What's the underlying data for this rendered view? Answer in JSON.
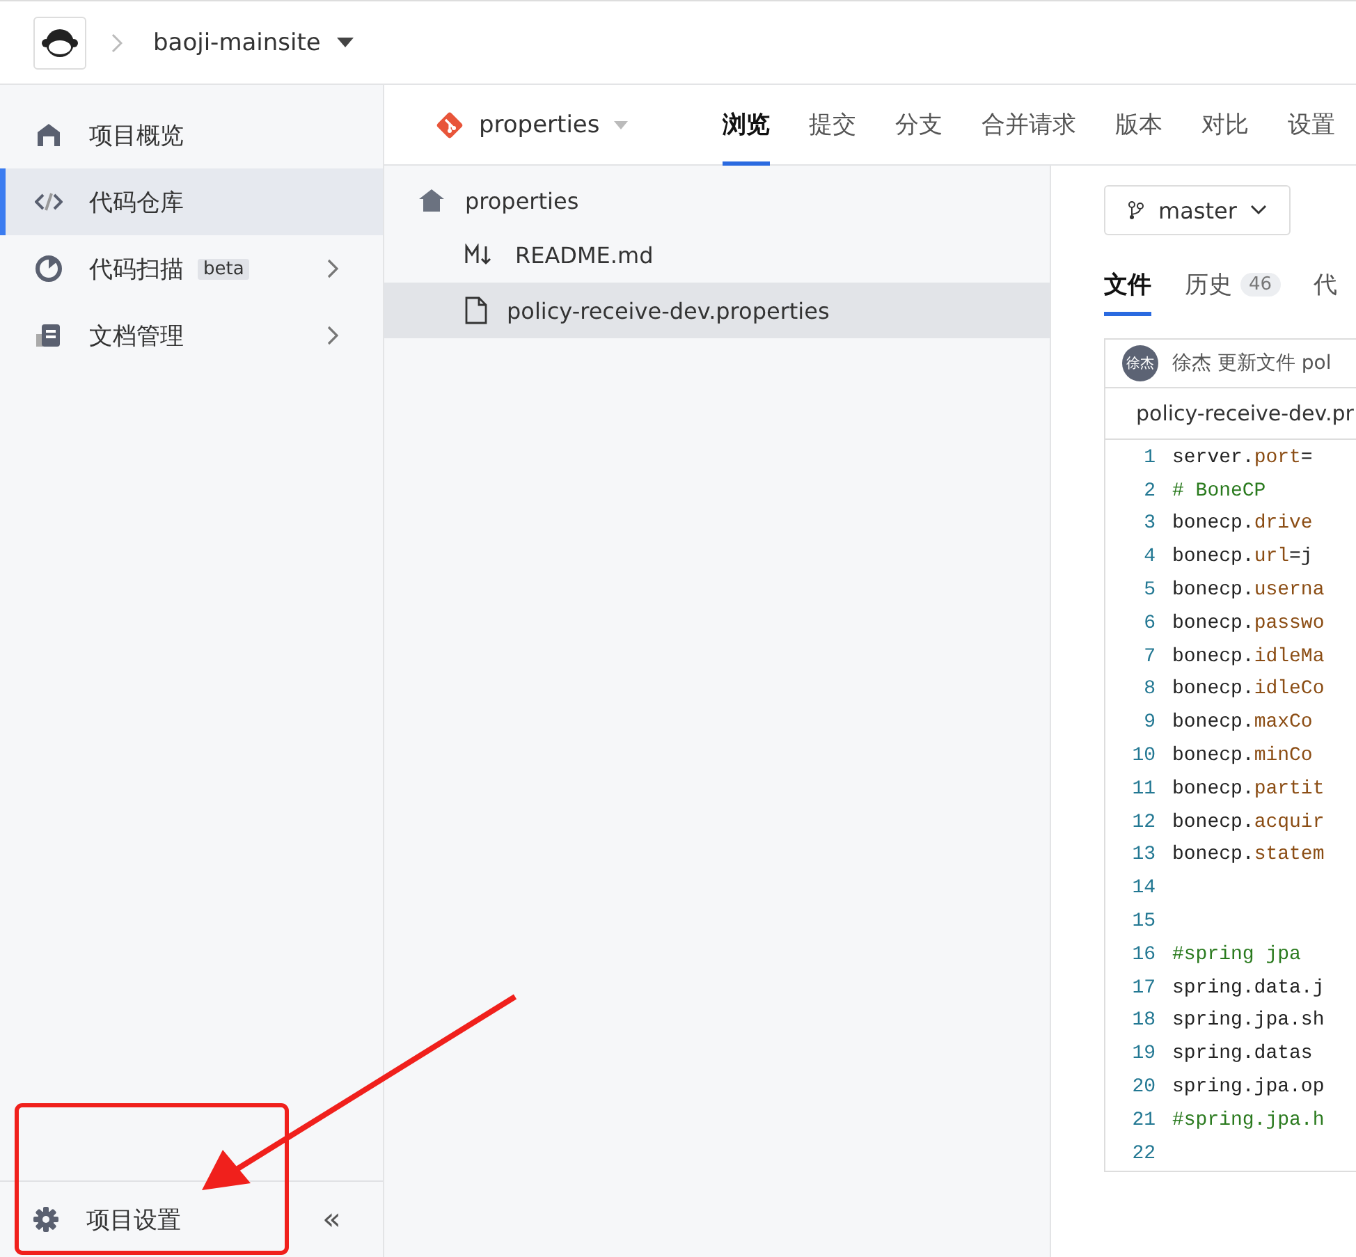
{
  "header": {
    "project": "baoji-mainsite"
  },
  "sidebar": {
    "items": [
      {
        "label": "项目概览",
        "kind": "home",
        "selected": false
      },
      {
        "label": "代码仓库",
        "kind": "code",
        "selected": true
      },
      {
        "label": "代码扫描",
        "kind": "scan",
        "badge": "beta",
        "selected": false,
        "expandable": true
      },
      {
        "label": "文档管理",
        "kind": "doc",
        "selected": false,
        "expandable": true
      }
    ],
    "footer_item": {
      "label": "项目设置"
    },
    "collapse": "«"
  },
  "repo": {
    "name": "properties",
    "tabs": [
      {
        "label": "浏览",
        "selected": true
      },
      {
        "label": "提交",
        "selected": false
      },
      {
        "label": "分支",
        "selected": false
      },
      {
        "label": "合并请求",
        "selected": false
      },
      {
        "label": "版本",
        "selected": false
      },
      {
        "label": "对比",
        "selected": false
      },
      {
        "label": "设置",
        "selected": false
      }
    ]
  },
  "file_tree": {
    "root": "properties",
    "files": [
      {
        "name": "README.md",
        "kind": "markdown",
        "selected": false
      },
      {
        "name": "policy-receive-dev.properties",
        "kind": "file",
        "selected": true
      }
    ]
  },
  "file_view": {
    "branch": "master",
    "tabs": [
      {
        "label": "文件",
        "selected": true
      },
      {
        "label": "历史",
        "count": "46",
        "selected": false
      },
      {
        "label": "代",
        "selected": false
      }
    ],
    "commit": {
      "avatar": "徐杰",
      "author": "徐杰",
      "message": "更新文件 pol"
    },
    "file_name": "policy-receive-dev.pr",
    "lines": [
      {
        "number": "1",
        "segments": [
          {
            "text": "server.",
            "kind": "plain"
          },
          {
            "text": "port",
            "kind": "key"
          },
          {
            "text": "=",
            "kind": "plain"
          }
        ]
      },
      {
        "number": "2",
        "segments": [
          {
            "text": "# BoneCP",
            "kind": "comment"
          }
        ]
      },
      {
        "number": "3",
        "segments": [
          {
            "text": "bonecp.",
            "kind": "plain"
          },
          {
            "text": "drive",
            "kind": "key"
          }
        ]
      },
      {
        "number": "4",
        "segments": [
          {
            "text": "bonecp.",
            "kind": "plain"
          },
          {
            "text": "url",
            "kind": "key"
          },
          {
            "text": "=j",
            "kind": "plain"
          }
        ]
      },
      {
        "number": "5",
        "segments": [
          {
            "text": "bonecp.",
            "kind": "plain"
          },
          {
            "text": "userna",
            "kind": "key"
          }
        ]
      },
      {
        "number": "6",
        "segments": [
          {
            "text": "bonecp.",
            "kind": "plain"
          },
          {
            "text": "passwo",
            "kind": "key"
          }
        ]
      },
      {
        "number": "7",
        "segments": [
          {
            "text": "bonecp.",
            "kind": "plain"
          },
          {
            "text": "idleMa",
            "kind": "key"
          }
        ]
      },
      {
        "number": "8",
        "segments": [
          {
            "text": "bonecp.",
            "kind": "plain"
          },
          {
            "text": "idleCo",
            "kind": "key"
          }
        ]
      },
      {
        "number": "9",
        "segments": [
          {
            "text": "bonecp.",
            "kind": "plain"
          },
          {
            "text": "maxCo",
            "kind": "key"
          }
        ]
      },
      {
        "number": "10",
        "segments": [
          {
            "text": "bonecp.",
            "kind": "plain"
          },
          {
            "text": "minCo",
            "kind": "key"
          }
        ]
      },
      {
        "number": "11",
        "segments": [
          {
            "text": "bonecp.",
            "kind": "plain"
          },
          {
            "text": "partit",
            "kind": "key"
          }
        ]
      },
      {
        "number": "12",
        "segments": [
          {
            "text": "bonecp.",
            "kind": "plain"
          },
          {
            "text": "acquir",
            "kind": "key"
          }
        ]
      },
      {
        "number": "13",
        "segments": [
          {
            "text": "bonecp.",
            "kind": "plain"
          },
          {
            "text": "statem",
            "kind": "key"
          }
        ]
      },
      {
        "number": "14"
      },
      {
        "number": "15"
      },
      {
        "number": "16",
        "segments": [
          {
            "text": "#spring jpa",
            "kind": "comment"
          }
        ]
      },
      {
        "number": "17",
        "segments": [
          {
            "text": "spring.data.j",
            "kind": "plain"
          }
        ]
      },
      {
        "number": "18",
        "segments": [
          {
            "text": "spring.jpa.sh",
            "kind": "plain"
          }
        ]
      },
      {
        "number": "19",
        "segments": [
          {
            "text": "spring.datas",
            "kind": "plain"
          }
        ]
      },
      {
        "number": "20",
        "segments": [
          {
            "text": "spring.jpa.op",
            "kind": "plain"
          }
        ]
      },
      {
        "number": "21",
        "segments": [
          {
            "text": "#spring.jpa.h",
            "kind": "comment"
          }
        ]
      },
      {
        "number": "22"
      }
    ]
  }
}
